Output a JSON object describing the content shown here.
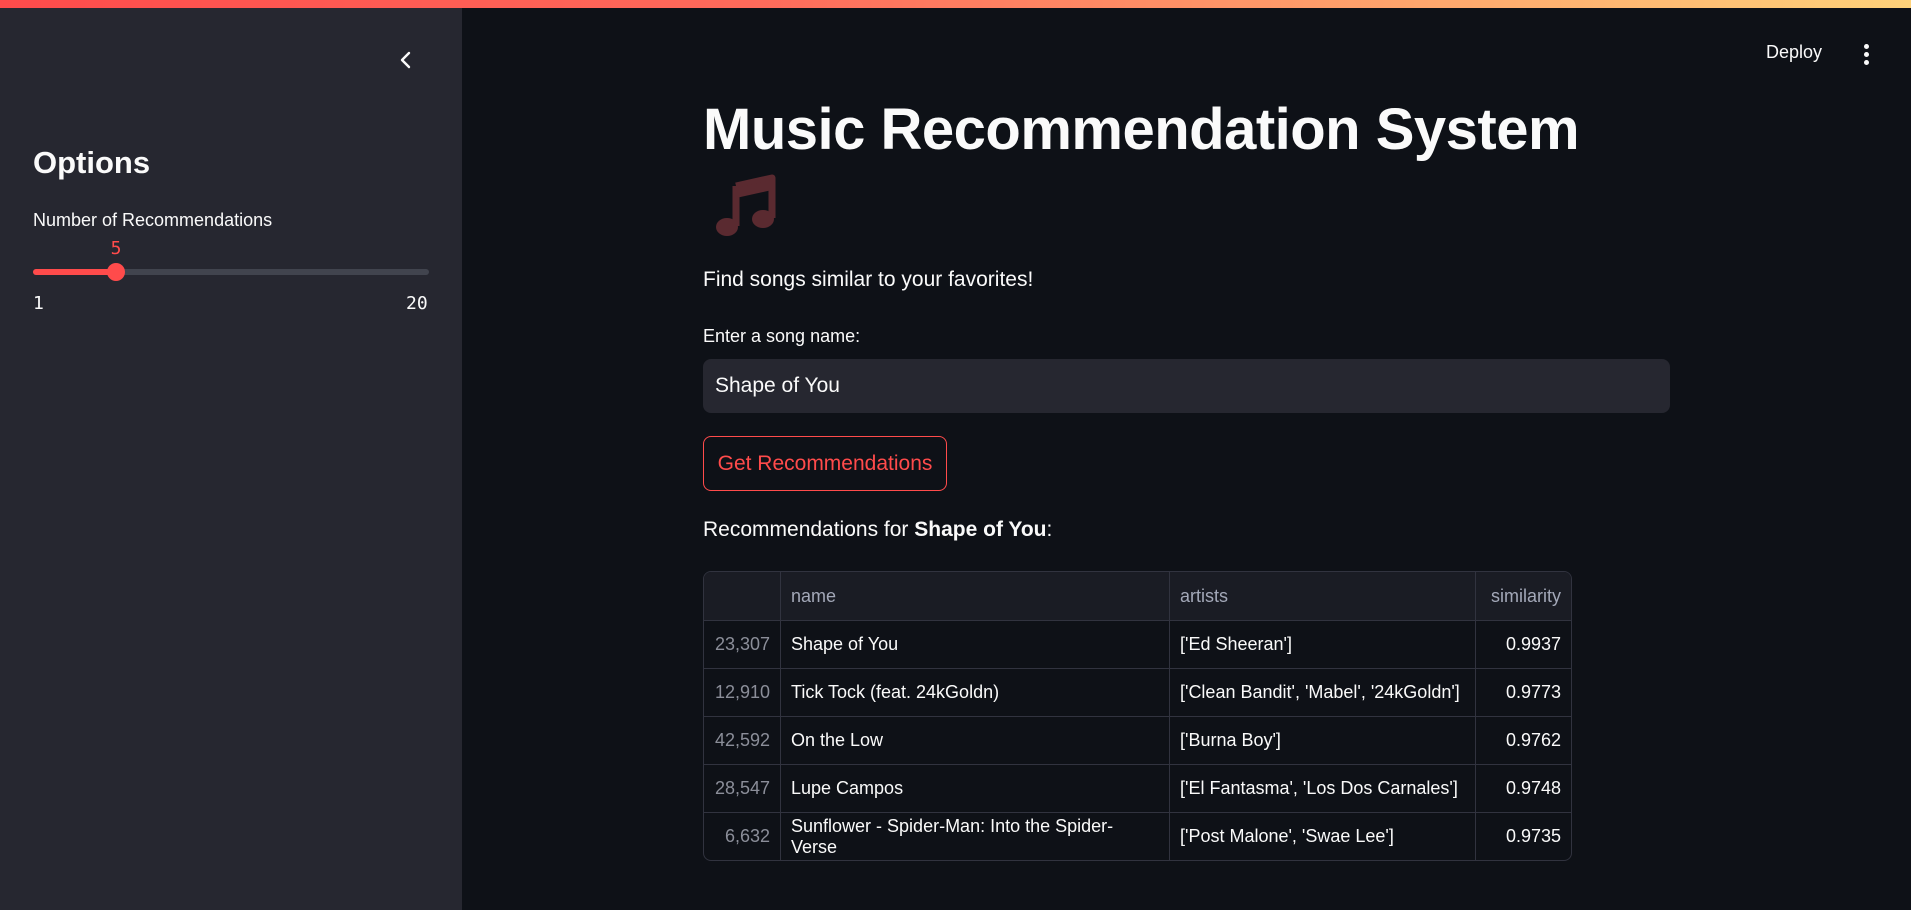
{
  "sidebar": {
    "title": "Options",
    "slider": {
      "label": "Number of Recommendations",
      "value": "5",
      "min": "1",
      "max": "20",
      "fraction": 0.2105
    }
  },
  "header": {
    "deploy_label": "Deploy"
  },
  "main": {
    "title": "Music Recommendation System",
    "subtitle": "Find songs similar to your favorites!",
    "input_label": "Enter a song name:",
    "input_value": "Shape of You",
    "button_label": "Get Recommendations",
    "rec_prefix": "Recommendations for ",
    "rec_song": "Shape of You",
    "rec_suffix": ":"
  },
  "table": {
    "columns": [
      "",
      "name",
      "artists",
      "similarity"
    ],
    "rows": [
      {
        "index": "23,307",
        "name": "Shape of You",
        "artists": "['Ed Sheeran']",
        "similarity": "0.9937"
      },
      {
        "index": "12,910",
        "name": "Tick Tock (feat. 24kGoldn)",
        "artists": "['Clean Bandit', 'Mabel', '24kGoldn']",
        "similarity": "0.9773"
      },
      {
        "index": "42,592",
        "name": "On the Low",
        "artists": "['Burna Boy']",
        "similarity": "0.9762"
      },
      {
        "index": "28,547",
        "name": "Lupe Campos",
        "artists": "['El Fantasma', 'Los Dos Carnales']",
        "similarity": "0.9748"
      },
      {
        "index": "6,632",
        "name": "Sunflower - Spider-Man: Into the Spider-Verse",
        "artists": "['Post Malone', 'Swae Lee']",
        "similarity": "0.9735"
      }
    ]
  },
  "icons": {
    "collapse": "chevron-left-icon",
    "menu": "more-vertical-icon",
    "title_emoji": "music-note-icon"
  },
  "colors": {
    "accent": "#ff4b4b",
    "background": "#0e1117",
    "sidebar": "#262730"
  }
}
